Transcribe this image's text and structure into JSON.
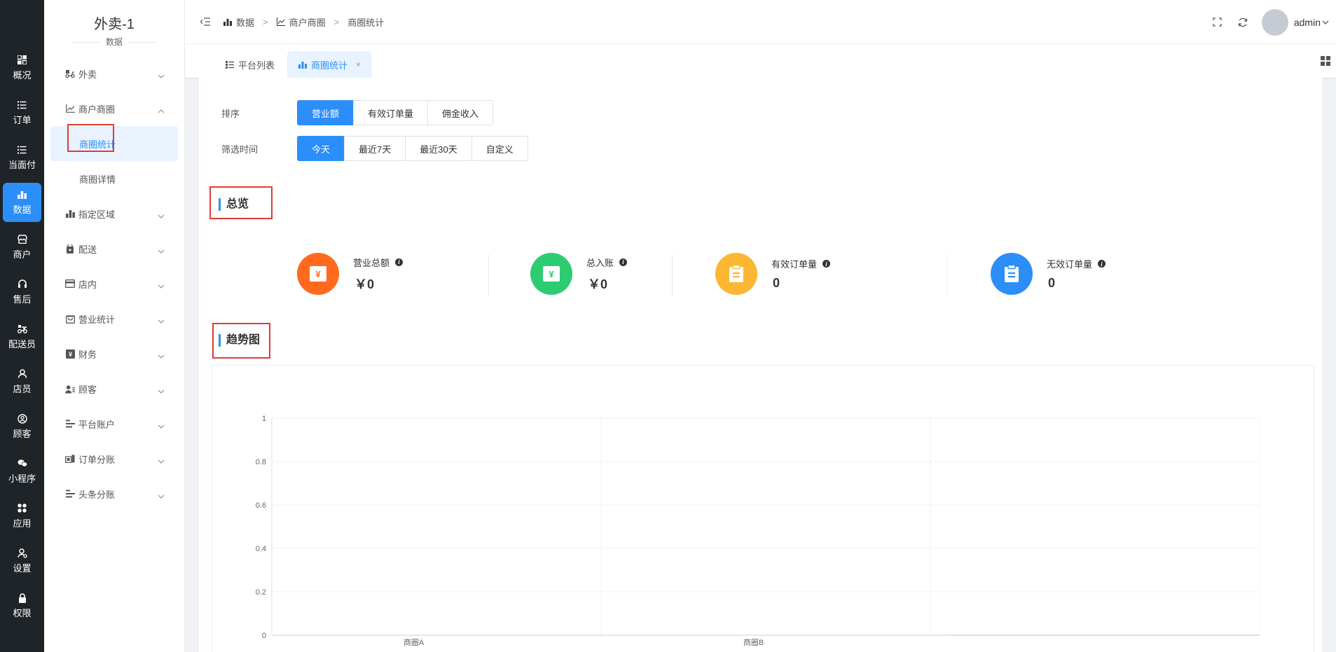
{
  "rail": {
    "items": [
      {
        "label": "概况",
        "icon": "dashboard-icon"
      },
      {
        "label": "订单",
        "icon": "list-icon"
      },
      {
        "label": "当面付",
        "icon": "list-icon"
      },
      {
        "label": "数据",
        "icon": "bar-chart-icon"
      },
      {
        "label": "商户",
        "icon": "store-icon"
      },
      {
        "label": "售后",
        "icon": "headset-icon"
      },
      {
        "label": "配送员",
        "icon": "delivery-icon"
      },
      {
        "label": "店员",
        "icon": "staff-icon"
      },
      {
        "label": "顾客",
        "icon": "user-circle-icon"
      },
      {
        "label": "小程序",
        "icon": "wechat-icon"
      },
      {
        "label": "应用",
        "icon": "apps-icon"
      },
      {
        "label": "设置",
        "icon": "settings-icon"
      },
      {
        "label": "权限",
        "icon": "lock-icon"
      }
    ],
    "active_index": 3
  },
  "subnav": {
    "title": "外卖-1",
    "subtitle": "数据",
    "groups": [
      {
        "label": "外卖",
        "icon": "takeout-icon",
        "expanded": false
      },
      {
        "label": "商户商圈",
        "icon": "line-chart-icon",
        "expanded": true,
        "children": [
          "商圈统计",
          "商圈详情"
        ]
      },
      {
        "label": "指定区域",
        "icon": "bar-chart-icon",
        "expanded": false
      },
      {
        "label": "配送",
        "icon": "delivery-box-icon",
        "expanded": false
      },
      {
        "label": "店内",
        "icon": "card-icon",
        "expanded": false
      },
      {
        "label": "营业统计",
        "icon": "shop-bag-icon",
        "expanded": false
      },
      {
        "label": "财务",
        "icon": "finance-icon",
        "expanded": false
      },
      {
        "label": "顾客",
        "icon": "users-icon",
        "expanded": false
      },
      {
        "label": "平台账户",
        "icon": "account-list-icon",
        "expanded": false
      },
      {
        "label": "订单分账",
        "icon": "split-icon",
        "expanded": false
      },
      {
        "label": "头条分账",
        "icon": "account-list-icon",
        "expanded": false
      }
    ]
  },
  "header": {
    "breadcrumb": [
      "数据",
      "商户商圈",
      "商圈统计"
    ],
    "username": "admin"
  },
  "tabs": [
    {
      "label": "平台列表",
      "active": false
    },
    {
      "label": "商圈统计",
      "active": true,
      "close": "×"
    }
  ],
  "filters": {
    "sort_label": "排序",
    "sort_options": [
      "营业额",
      "有效订单量",
      "佣金收入"
    ],
    "sort_active": 0,
    "time_label": "筛选时间",
    "time_options": [
      "今天",
      "最近7天",
      "最近30天",
      "自定义"
    ],
    "time_active": 0
  },
  "overview": {
    "title": "总览",
    "stats": [
      {
        "label": "营业总额",
        "value": "￥0",
        "color": "#ff6a1f",
        "icon": "yen-icon"
      },
      {
        "label": "总入账",
        "value": "￥0",
        "color": "#2ecc71",
        "icon": "yen-icon"
      },
      {
        "label": "有效订单量",
        "value": "0",
        "color": "#fbb731",
        "icon": "clipboard-icon"
      },
      {
        "label": "无效订单量",
        "value": "0",
        "color": "#2c8ef8",
        "icon": "clipboard-icon"
      }
    ]
  },
  "trend": {
    "title": "趋势图"
  },
  "chart_data": {
    "type": "bar",
    "categories": [
      "商圈A",
      "商圈B"
    ],
    "values": [
      0,
      0
    ],
    "title": "",
    "xlabel": "",
    "ylabel": "",
    "ylim": [
      0,
      1
    ],
    "yticks": [
      "0",
      "0.2",
      "0.4",
      "0.6",
      "0.8",
      "1"
    ],
    "grid": true
  }
}
